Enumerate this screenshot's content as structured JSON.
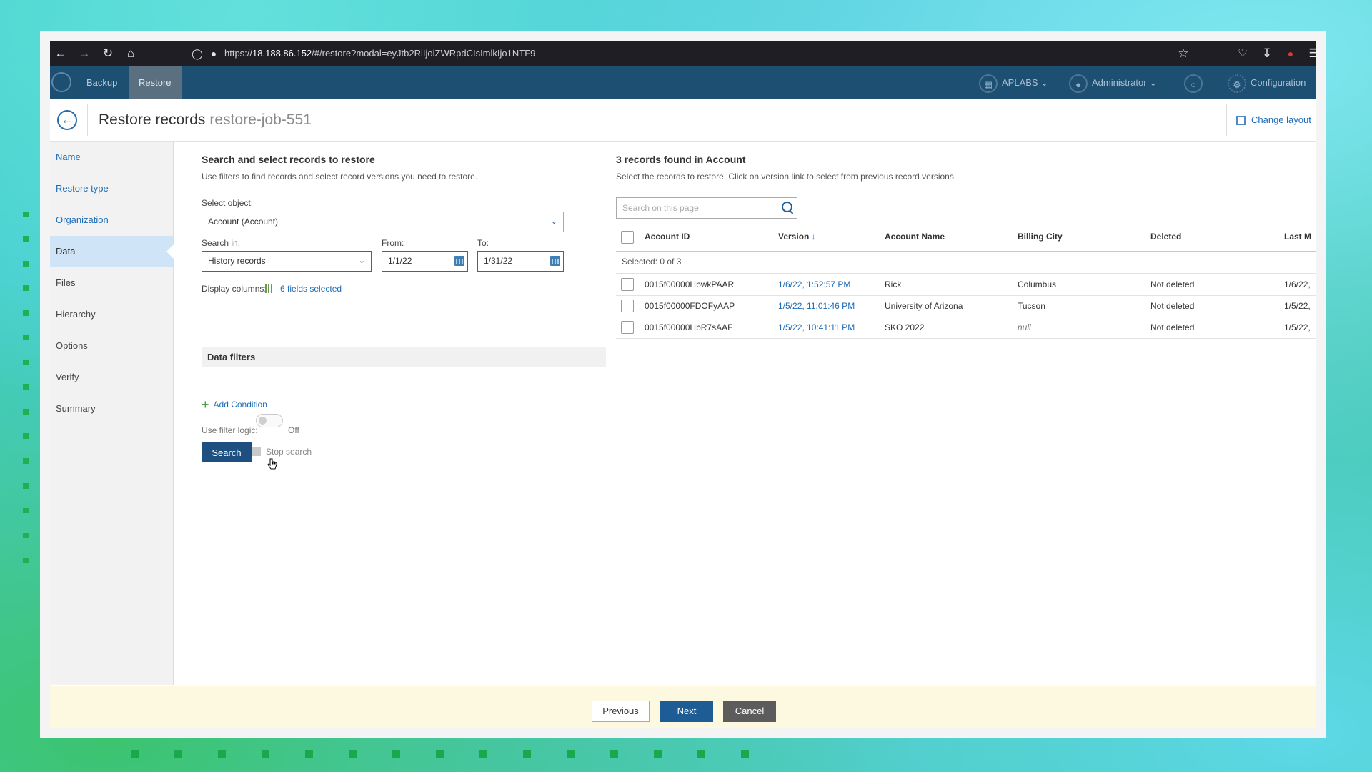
{
  "browser": {
    "url_prefix": "https://",
    "url_host": "18.188.86.152",
    "url_path": "/#/restore?modal=eyJtb2RlIjoiZWRpdCIsImlkIjo1NTF9"
  },
  "header": {
    "tabs": [
      {
        "label": "Backup"
      },
      {
        "label": "Restore"
      }
    ],
    "org": "APLABS",
    "user": "Administrator",
    "config": "Configuration"
  },
  "page": {
    "title": "Restore records",
    "job": "restore-job-551",
    "change_layout": "Change layout"
  },
  "sidebar": {
    "items": [
      {
        "label": "Name"
      },
      {
        "label": "Restore type"
      },
      {
        "label": "Organization"
      },
      {
        "label": "Data"
      },
      {
        "label": "Files"
      },
      {
        "label": "Hierarchy"
      },
      {
        "label": "Options"
      },
      {
        "label": "Verify"
      },
      {
        "label": "Summary"
      }
    ]
  },
  "left": {
    "heading": "Search and select records to restore",
    "description": "Use filters to find records and select record versions you need to restore.",
    "select_object_label": "Select object:",
    "select_object_value": "Account (Account)",
    "search_in_label": "Search in:",
    "search_in_value": "History records",
    "from_label": "From:",
    "from_value": "1/1/22",
    "to_label": "To:",
    "to_value": "1/31/22",
    "display_columns_label": "Display columns:",
    "display_columns_value": "6 fields selected",
    "data_filters": "Data filters",
    "add_condition": "Add Condition",
    "filter_logic_label": "Use filter logic:",
    "filter_logic_state": "Off",
    "search_button": "Search",
    "stop_search": "Stop search"
  },
  "right": {
    "heading": "3 records found in Account",
    "description": "Select the records to restore. Click on version link to select from previous record versions.",
    "search_placeholder": "Search on this page",
    "columns": [
      "Account ID",
      "Version",
      "Account Name",
      "Billing City",
      "Deleted",
      "Last M"
    ],
    "selected": "Selected:  0 of 3",
    "rows": [
      {
        "id": "0015f00000HbwkPAAR",
        "version": "1/6/22, 1:52:57 PM",
        "name": "Rick",
        "city": "Columbus",
        "deleted": "Not deleted",
        "last": "1/6/22,"
      },
      {
        "id": "0015f00000FDOFyAAP",
        "version": "1/5/22, 11:01:46 PM",
        "name": "University of Arizona",
        "city": "Tucson",
        "deleted": "Not deleted",
        "last": "1/5/22,"
      },
      {
        "id": "0015f00000HbR7sAAF",
        "version": "1/5/22, 10:41:11 PM",
        "name": "SKO 2022",
        "city": "null",
        "deleted": "Not deleted",
        "last": "1/5/22,"
      }
    ]
  },
  "footer": {
    "previous": "Previous",
    "next": "Next",
    "cancel": "Cancel"
  }
}
